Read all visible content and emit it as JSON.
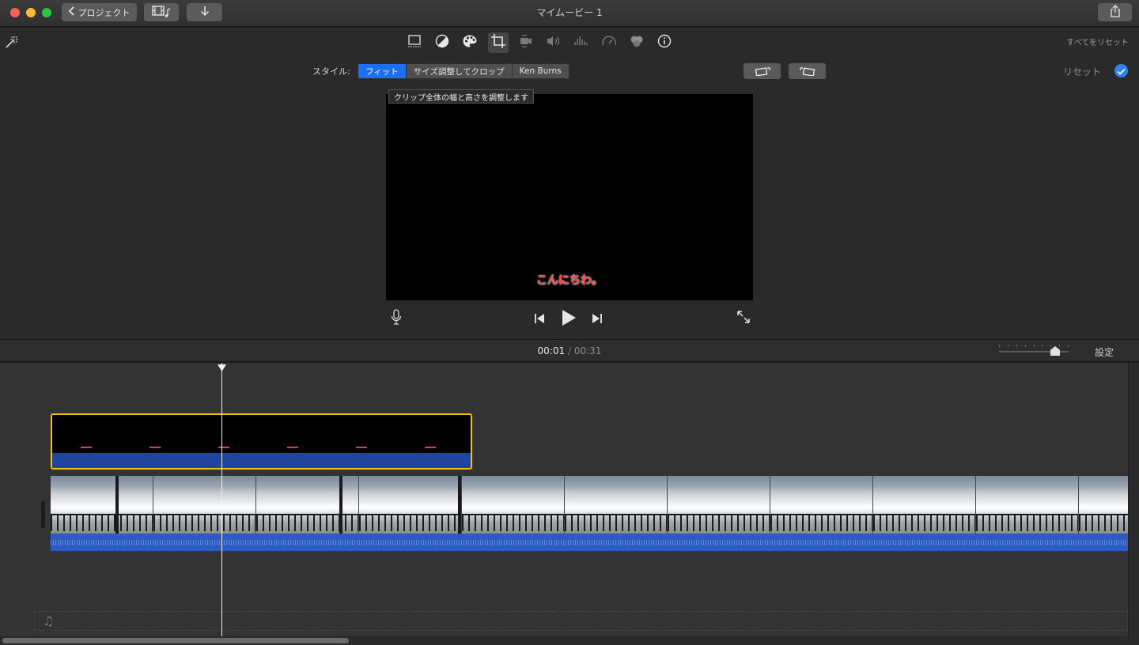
{
  "titlebar": {
    "window_title": "マイムービー 1",
    "back_label": "プロジェクト"
  },
  "toolbar": {
    "tools": [
      "crop-to-fill-icon",
      "color-balance-icon",
      "color-palette-icon",
      "crop-icon",
      "stabilization-icon",
      "volume-icon",
      "noise-reduction-icon",
      "speed-icon",
      "video-overlay-icon",
      "info-icon"
    ],
    "active_tool": "crop-icon",
    "reset_all_label": "すべてをリセット"
  },
  "style_row": {
    "label": "スタイル:",
    "options": [
      "フィット",
      "サイズ調整してクロップ",
      "Ken Burns"
    ],
    "selected": "フィット",
    "reset_label": "リセット",
    "accent": "#1c6ef2"
  },
  "viewer": {
    "tooltip": "クリップ全体の幅と高さを調整します",
    "subtitle": "こんにちわ。"
  },
  "timecode": {
    "current": "00:01",
    "separator": "/",
    "total": "00:31"
  },
  "timeline_header": {
    "settings_label": "設定"
  },
  "timeline": {
    "title_clip_color": "#f2c200",
    "audio_color": "#2d5bbf",
    "frame_count": 11
  }
}
